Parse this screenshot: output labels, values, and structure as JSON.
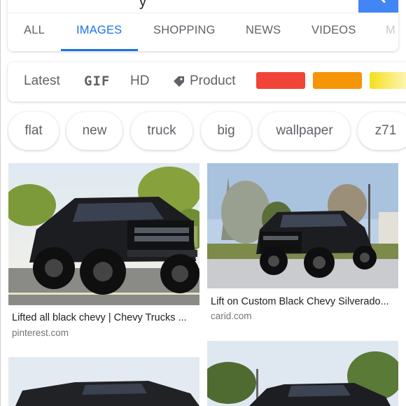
{
  "search": {
    "query_fragment": "y"
  },
  "tabs": [
    "ALL",
    "IMAGES",
    "SHOPPING",
    "NEWS",
    "VIDEOS",
    "M"
  ],
  "active_tab": "IMAGES",
  "filters": {
    "latest": "Latest",
    "gif": "GIF",
    "hd": "HD",
    "product": "Product",
    "color_swatches": [
      "#f04438",
      "#f59507",
      "#f5e01a"
    ]
  },
  "chips": [
    "flat",
    "new",
    "truck",
    "big",
    "wallpaper",
    "z71"
  ],
  "results": [
    {
      "title": "Lifted all black chevy | Chevy Trucks ...",
      "domain": "pinterest.com"
    },
    {
      "title": "Lift on Custom Black Chevy Silverado...",
      "domain": "carid.com"
    }
  ],
  "colors": {
    "accent": "#1a73e8",
    "search_button": "#4285f4"
  }
}
